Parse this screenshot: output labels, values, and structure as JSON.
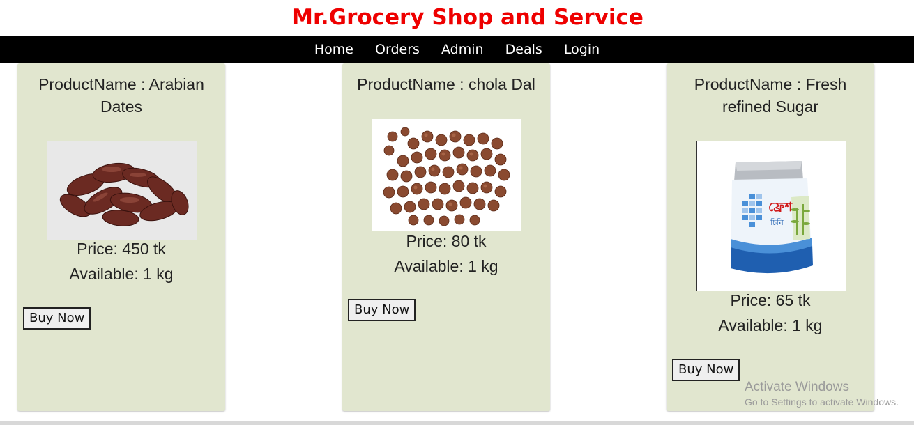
{
  "header": {
    "title": "Mr.Grocery Shop and Service"
  },
  "nav": {
    "items": [
      "Home",
      "Orders",
      "Admin",
      "Deals",
      "Login"
    ]
  },
  "products": [
    {
      "name": "ProductName : Arabian Dates",
      "price": "Price: 450 tk",
      "available": "Available: 1 kg",
      "button": "Buy Now",
      "image_icon": "dates-image"
    },
    {
      "name": "ProductName : chola Dal",
      "price": "Price: 80 tk",
      "available": "Available: 1 kg",
      "button": "Buy Now",
      "image_icon": "chickpeas-image"
    },
    {
      "name": "ProductName : Fresh refined Sugar",
      "price": "Price: 65 tk",
      "available": "Available: 1 kg",
      "button": "Buy Now",
      "image_icon": "sugar-pack-image"
    }
  ],
  "sugar_pack": {
    "brand": "ফ্রেশ",
    "subtitle": "চিনি"
  },
  "watermark": {
    "line1": "Activate Windows",
    "line2": "Go to Settings to activate Windows."
  },
  "colors": {
    "title": "#ee0000",
    "nav_bg": "#000000",
    "card_bg": "#e1e6cf"
  }
}
